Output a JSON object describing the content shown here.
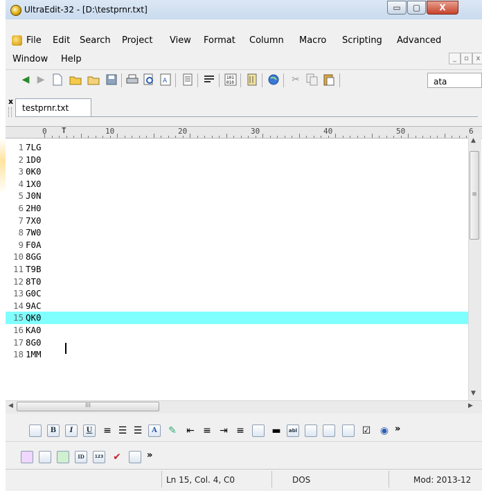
{
  "window": {
    "title": "UltraEdit-32 - [D:\\testprnr.txt]",
    "caption_buttons": {
      "minimize": "▭",
      "maximize": "▢",
      "close": "X"
    }
  },
  "menu": {
    "items": [
      "File",
      "Edit",
      "Search",
      "Project",
      "View",
      "Format",
      "Column",
      "Macro",
      "Scripting",
      "Advanced",
      "Window",
      "Help"
    ],
    "mdi_buttons": [
      "_",
      "▫",
      "x"
    ]
  },
  "toolbar": {
    "search_value": "ata"
  },
  "tab": {
    "label": "testprnr.txt",
    "close_glyph": "x"
  },
  "ruler": {
    "labels": [
      "0",
      "10",
      "20",
      "30",
      "40",
      "50",
      "6"
    ],
    "marker": "T"
  },
  "editor": {
    "lines": [
      {
        "num": "1",
        "text": "7LG"
      },
      {
        "num": "2",
        "text": "1D0"
      },
      {
        "num": "3",
        "text": "0K0"
      },
      {
        "num": "4",
        "text": "1X0"
      },
      {
        "num": "5",
        "text": "J0N"
      },
      {
        "num": "6",
        "text": "2H0"
      },
      {
        "num": "7",
        "text": "7X0"
      },
      {
        "num": "8",
        "text": "7W0"
      },
      {
        "num": "9",
        "text": "F0A"
      },
      {
        "num": "10",
        "text": "8GG"
      },
      {
        "num": "11",
        "text": "T9B"
      },
      {
        "num": "12",
        "text": "8T0"
      },
      {
        "num": "13",
        "text": "G0C"
      },
      {
        "num": "14",
        "text": "9AC"
      },
      {
        "num": "15",
        "text": "QK0"
      },
      {
        "num": "16",
        "text": "KA0"
      },
      {
        "num": "17",
        "text": "8G0"
      },
      {
        "num": "18",
        "text": "1MM"
      }
    ],
    "active_line": 15
  },
  "scrollbars": {
    "hthumb_grip": "III",
    "vthumb_grip": "≡"
  },
  "bottom_toolbar": {
    "more": "»",
    "icon_labels": [
      "B",
      "I",
      "U",
      "A",
      "abl",
      "ID",
      "123"
    ]
  },
  "status": {
    "position": "Ln 15, Col. 4, C0",
    "line_ending": "DOS",
    "modified": "Mod: 2013-12"
  },
  "colors": {
    "active_line": "#80ffff",
    "titlebar": "#c9dbee"
  }
}
